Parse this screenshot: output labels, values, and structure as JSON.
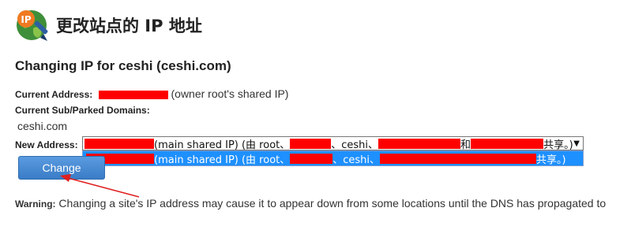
{
  "header": {
    "icon_badge": "IP",
    "title": "更改站点的 IP 地址"
  },
  "subtitle": "Changing IP for ceshi (ceshi.com)",
  "current_address": {
    "label": "Current Address:",
    "note": "(owner root's shared IP)"
  },
  "sub_domains": {
    "label": "Current Sub/Parked Domains:",
    "value": "ceshi.com"
  },
  "new_address": {
    "label": "New Address:",
    "selected": {
      "part1": " (main shared IP) (由 root、",
      "part2": "、ceshi、",
      "part3": "和",
      "part4": " 共享。)"
    },
    "option": {
      "part1": " (main shared IP) (由 root、",
      "part2": "、ceshi、",
      "part3": "共享。)"
    }
  },
  "change_button": "Change",
  "warning": {
    "label": "Warning:",
    "text": " Changing a site's IP address may cause it to appear down from some locations until the DNS has propagated to"
  },
  "colors": {
    "redaction": "#ff0000",
    "option_highlight": "#1e90ff",
    "button": "#4a8bd6",
    "annotation_arrow": "#e02020"
  }
}
